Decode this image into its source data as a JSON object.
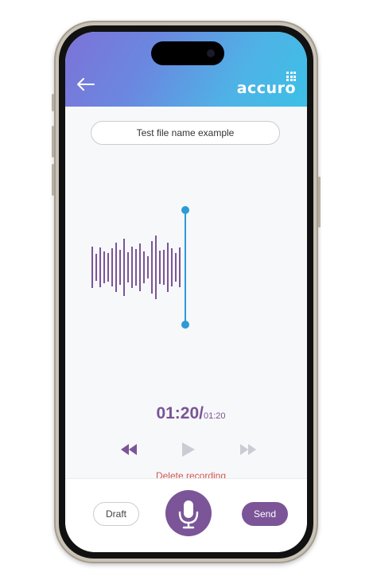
{
  "header": {
    "logo_text": "accuro",
    "gradient_start": "#7d72d8",
    "gradient_end": "#3cc0e6"
  },
  "recording": {
    "file_name": "Test file name example",
    "current_time": "01:20",
    "separator": "/",
    "total_time": "01:20",
    "delete_label": "Delete recording"
  },
  "controls": {
    "rewind_icon": "rewind-icon",
    "play_icon": "play-icon",
    "fast_forward_icon": "fast-forward-icon"
  },
  "bottom_bar": {
    "draft_label": "Draft",
    "send_label": "Send",
    "mic_icon": "microphone-icon"
  },
  "colors": {
    "accent": "#7b5598",
    "playhead": "#2e9ad6",
    "delete": "#d3584f"
  }
}
